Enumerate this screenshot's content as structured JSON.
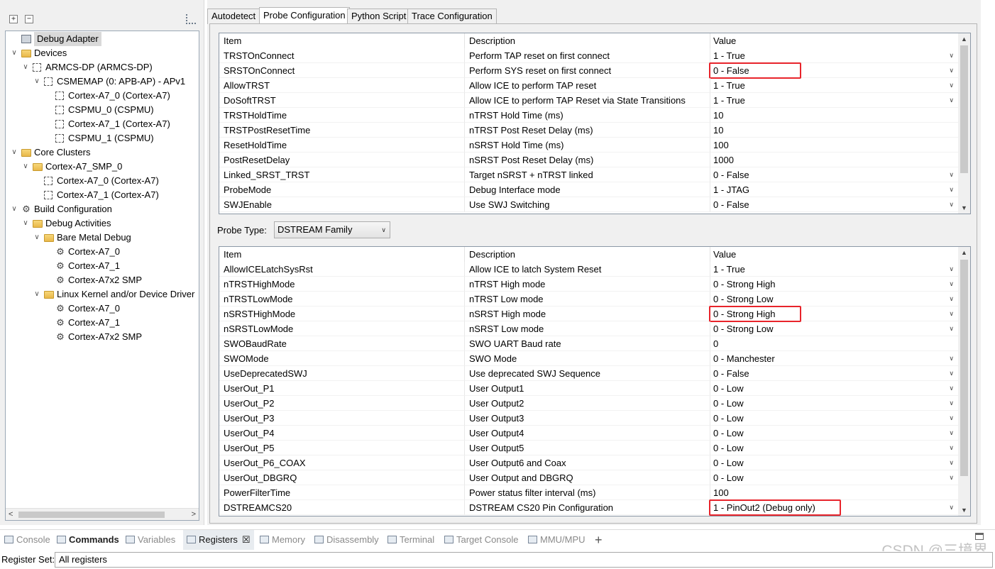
{
  "tree": {
    "items": [
      {
        "label": "Debug Adapter",
        "icon": "adapter",
        "depth": 0,
        "twisty": "",
        "selected": true
      },
      {
        "label": "Devices",
        "icon": "folder",
        "depth": 0,
        "twisty": "∨"
      },
      {
        "label": "ARMCS-DP (ARMCS-DP)",
        "icon": "chip",
        "depth": 1,
        "twisty": "∨"
      },
      {
        "label": "CSMEMAP (0: APB-AP) - APv1",
        "icon": "chip",
        "depth": 2,
        "twisty": "∨"
      },
      {
        "label": "Cortex-A7_0 (Cortex-A7)",
        "icon": "chip",
        "depth": 3,
        "twisty": ""
      },
      {
        "label": "CSPMU_0 (CSPMU)",
        "icon": "chip",
        "depth": 3,
        "twisty": ""
      },
      {
        "label": "Cortex-A7_1 (Cortex-A7)",
        "icon": "chip",
        "depth": 3,
        "twisty": ""
      },
      {
        "label": "CSPMU_1 (CSPMU)",
        "icon": "chip",
        "depth": 3,
        "twisty": ""
      },
      {
        "label": "Core Clusters",
        "icon": "folder",
        "depth": 0,
        "twisty": "∨"
      },
      {
        "label": "Cortex-A7_SMP_0",
        "icon": "folder",
        "depth": 1,
        "twisty": "∨"
      },
      {
        "label": "Cortex-A7_0 (Cortex-A7)",
        "icon": "chip",
        "depth": 2,
        "twisty": ""
      },
      {
        "label": "Cortex-A7_1 (Cortex-A7)",
        "icon": "chip",
        "depth": 2,
        "twisty": ""
      },
      {
        "label": "Build Configuration",
        "icon": "gear",
        "depth": 0,
        "twisty": "∨"
      },
      {
        "label": "Debug Activities",
        "icon": "folder",
        "depth": 1,
        "twisty": "∨"
      },
      {
        "label": "Bare Metal Debug",
        "icon": "folder",
        "depth": 2,
        "twisty": "∨"
      },
      {
        "label": "Cortex-A7_0",
        "icon": "gear",
        "depth": 3,
        "twisty": ""
      },
      {
        "label": "Cortex-A7_1",
        "icon": "gear",
        "depth": 3,
        "twisty": ""
      },
      {
        "label": "Cortex-A7x2 SMP",
        "icon": "gear",
        "depth": 3,
        "twisty": ""
      },
      {
        "label": "Linux Kernel and/or Device Driver",
        "icon": "folder",
        "depth": 2,
        "twisty": "∨"
      },
      {
        "label": "Cortex-A7_0",
        "icon": "gear",
        "depth": 3,
        "twisty": ""
      },
      {
        "label": "Cortex-A7_1",
        "icon": "gear",
        "depth": 3,
        "twisty": ""
      },
      {
        "label": "Cortex-A7x2 SMP",
        "icon": "gear",
        "depth": 3,
        "twisty": ""
      }
    ],
    "expand_all_label": "+",
    "collapse_all_label": "−"
  },
  "tabs": [
    {
      "label": "Autodetect"
    },
    {
      "label": "Probe Configuration",
      "active": true
    },
    {
      "label": "Python Script"
    },
    {
      "label": "Trace Configuration"
    }
  ],
  "headers": {
    "item": "Item",
    "description": "Description",
    "value": "Value"
  },
  "grid1": {
    "rows": [
      {
        "item": "TRSTOnConnect",
        "description": "Perform TAP reset on first connect",
        "value": "1 - True",
        "dropdown": true
      },
      {
        "item": "SRSTOnConnect",
        "description": "Perform SYS reset on first connect",
        "value": "0 - False",
        "dropdown": true,
        "highlight": true
      },
      {
        "item": "AllowTRST",
        "description": "Allow ICE to perform TAP reset",
        "value": "1 - True",
        "dropdown": true
      },
      {
        "item": "DoSoftTRST",
        "description": "Allow ICE to perform TAP Reset via State Transitions",
        "value": "1 - True",
        "dropdown": true
      },
      {
        "item": "TRSTHoldTime",
        "description": "nTRST Hold Time (ms)",
        "value": "10",
        "dropdown": false
      },
      {
        "item": "TRSTPostResetTime",
        "description": "nTRST Post Reset Delay (ms)",
        "value": "10",
        "dropdown": false
      },
      {
        "item": "ResetHoldTime",
        "description": "nSRST Hold Time (ms)",
        "value": "100",
        "dropdown": false
      },
      {
        "item": "PostResetDelay",
        "description": "nSRST Post Reset Delay (ms)",
        "value": "1000",
        "dropdown": false
      },
      {
        "item": "Linked_SRST_TRST",
        "description": "Target nSRST + nTRST linked",
        "value": "0 - False",
        "dropdown": true
      },
      {
        "item": "ProbeMode",
        "description": "Debug Interface mode",
        "value": "1 - JTAG",
        "dropdown": true
      },
      {
        "item": "SWJEnable",
        "description": "Use SWJ Switching",
        "value": "0 - False",
        "dropdown": true
      }
    ]
  },
  "probe_type": {
    "label": "Probe Type:",
    "value": "DSTREAM Family"
  },
  "grid2": {
    "rows": [
      {
        "item": "AllowICELatchSysRst",
        "description": "Allow ICE to latch System Reset",
        "value": "1 - True",
        "dropdown": true
      },
      {
        "item": "nTRSTHighMode",
        "description": "nTRST High mode",
        "value": "0 - Strong High",
        "dropdown": true
      },
      {
        "item": "nTRSTLowMode",
        "description": "nTRST Low mode",
        "value": "0 - Strong Low",
        "dropdown": true
      },
      {
        "item": "nSRSTHighMode",
        "description": "nSRST High mode",
        "value": "0 - Strong High",
        "dropdown": true,
        "highlight": true
      },
      {
        "item": "nSRSTLowMode",
        "description": "nSRST Low mode",
        "value": "0 - Strong Low",
        "dropdown": true
      },
      {
        "item": "SWOBaudRate",
        "description": "SWO UART Baud rate",
        "value": "0",
        "dropdown": false
      },
      {
        "item": "SWOMode",
        "description": "SWO Mode",
        "value": "0 - Manchester",
        "dropdown": true
      },
      {
        "item": "UseDeprecatedSWJ",
        "description": "Use deprecated SWJ Sequence",
        "value": "0 - False",
        "dropdown": true
      },
      {
        "item": "UserOut_P1",
        "description": "User Output1",
        "value": "0 - Low",
        "dropdown": true
      },
      {
        "item": "UserOut_P2",
        "description": "User Output2",
        "value": "0 - Low",
        "dropdown": true
      },
      {
        "item": "UserOut_P3",
        "description": "User Output3",
        "value": "0 - Low",
        "dropdown": true
      },
      {
        "item": "UserOut_P4",
        "description": "User Output4",
        "value": "0 - Low",
        "dropdown": true
      },
      {
        "item": "UserOut_P5",
        "description": "User Output5",
        "value": "0 - Low",
        "dropdown": true
      },
      {
        "item": "UserOut_P6_COAX",
        "description": "User Output6 and Coax",
        "value": "0 - Low",
        "dropdown": true
      },
      {
        "item": "UserOut_DBGRQ",
        "description": "User Output and DBGRQ",
        "value": "0 - Low",
        "dropdown": true
      },
      {
        "item": "PowerFilterTime",
        "description": "Power status filter interval (ms)",
        "value": "100",
        "dropdown": false
      },
      {
        "item": "DSTREAMCS20",
        "description": "DSTREAM CS20 Pin Configuration",
        "value": "1 - PinOut2 (Debug only)",
        "dropdown": true,
        "highlight": true
      }
    ]
  },
  "bottom_tabs": [
    {
      "label": "Console",
      "icon": "console-icon"
    },
    {
      "label": "Commands",
      "icon": "commands-icon",
      "bold": true
    },
    {
      "label": "Variables",
      "icon": "variables-icon"
    },
    {
      "label": "Registers",
      "icon": "registers-icon",
      "active": true,
      "close": "☒"
    },
    {
      "label": "Memory",
      "icon": "memory-icon"
    },
    {
      "label": "Disassembly",
      "icon": "disassembly-icon"
    },
    {
      "label": "Terminal",
      "icon": "terminal-icon"
    },
    {
      "label": "Target Console",
      "icon": "target-console-icon"
    },
    {
      "label": "MMU/MPU",
      "icon": "mmu-icon"
    },
    {
      "label": "+",
      "icon": "add-icon"
    }
  ],
  "register_set": {
    "label": "Register Set:",
    "value": "All registers"
  },
  "watermark": "CSDN @三境界",
  "colors": {
    "highlight": "#e8242b"
  }
}
